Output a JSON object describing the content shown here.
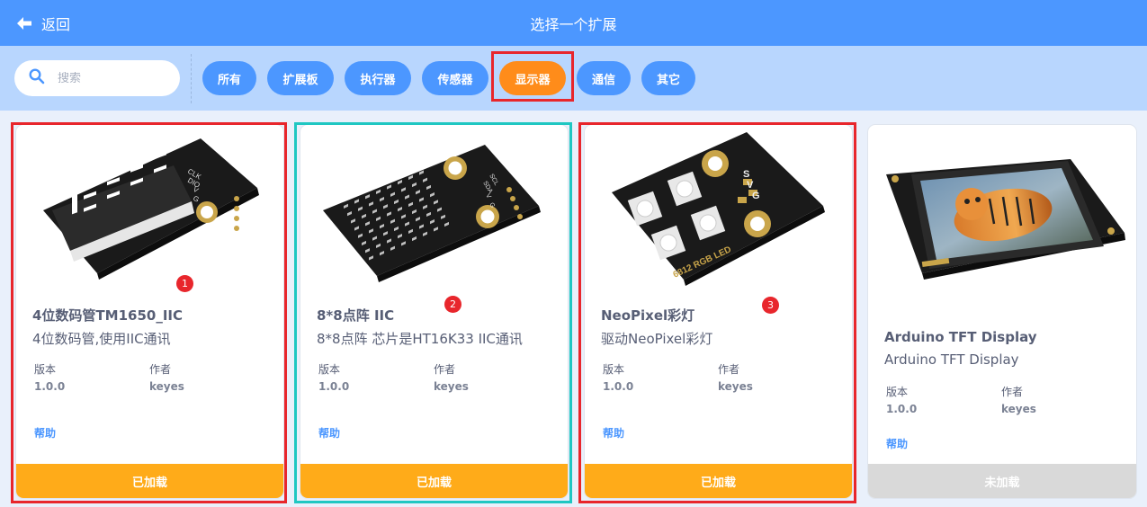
{
  "header": {
    "back_label": "返回",
    "title": "选择一个扩展",
    "background": "#4c97ff"
  },
  "filter": {
    "search_placeholder": "搜索",
    "tags": [
      "所有",
      "扩展板",
      "执行器",
      "传感器",
      "显示器",
      "通信",
      "其它"
    ],
    "active_tag": "显示器",
    "tag_color": "#4c97ff",
    "active_tag_color": "#ff8c1a"
  },
  "labels": {
    "version": "版本",
    "author": "作者",
    "help": "帮助"
  },
  "cards": [
    {
      "name": "4位数码管TM1650_IIC",
      "description": "4位数码管,使用IIC通讯",
      "version": "1.0.0",
      "author": "keyes",
      "status": "已加载",
      "badge": "1",
      "image_icon": "four-digit-display-module"
    },
    {
      "name": "8*8点阵 IIC",
      "description": "8*8点阵 芯片是HT16K33 IIC通讯",
      "version": "1.0.0",
      "author": "keyes",
      "status": "已加载",
      "badge": "2",
      "image_icon": "dot-matrix-module"
    },
    {
      "name": "NeoPixel彩灯",
      "description": "驱动NeoPixel彩灯",
      "version": "1.0.0",
      "author": "keyes",
      "status": "已加载",
      "badge": "3",
      "image_icon": "rgb-led-module"
    },
    {
      "name": "Arduino TFT Display",
      "description": "Arduino TFT Display",
      "version": "1.0.0",
      "author": "keyes",
      "status": "未加载",
      "image_icon": "tft-display-module"
    }
  ],
  "module_prints": {
    "card0": [
      "CLK",
      "DIO",
      "V",
      "G"
    ],
    "card1": [
      "SCL",
      "SDA",
      "V",
      "G"
    ],
    "card2": [
      "S",
      "V",
      "G",
      "6812 RGB LED"
    ]
  },
  "colors": {
    "loaded": "#ffab19",
    "unloaded": "#d9d9d9",
    "outline_red": "#e8262c",
    "outline_teal": "#1fc7c2"
  }
}
